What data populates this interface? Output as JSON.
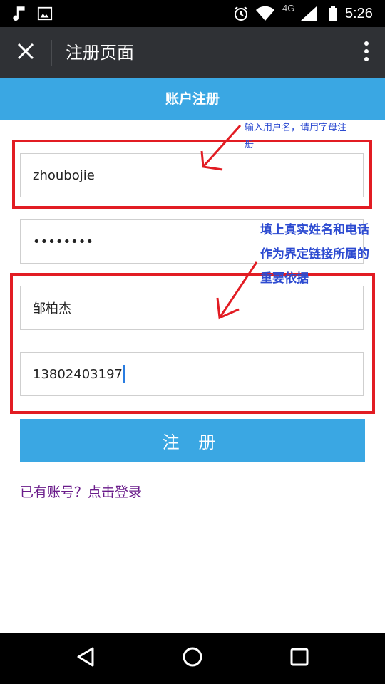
{
  "status_bar": {
    "network": "4G",
    "time": "5:26"
  },
  "title_bar": {
    "title": "注册页面"
  },
  "header": {
    "title": "账户注册"
  },
  "form": {
    "username": "zhoubojie",
    "password_masked": "••••••••",
    "real_name": "邹柏杰",
    "phone": "13802403197",
    "submit_label": "注 册"
  },
  "login_link": "已有账号？点击登录",
  "annotations": {
    "note_username": "输入用户名，请用字母注册",
    "note_name_phone_line1": "填上真实姓名和电话",
    "note_name_phone_line2": "作为界定链接所属的重要依据"
  },
  "colors": {
    "accent": "#3aa7e3",
    "title_bar": "#2f3135",
    "annotation_red": "#e21c23",
    "annotation_blue": "#2d4bd1",
    "link": "#6a1b8a"
  }
}
